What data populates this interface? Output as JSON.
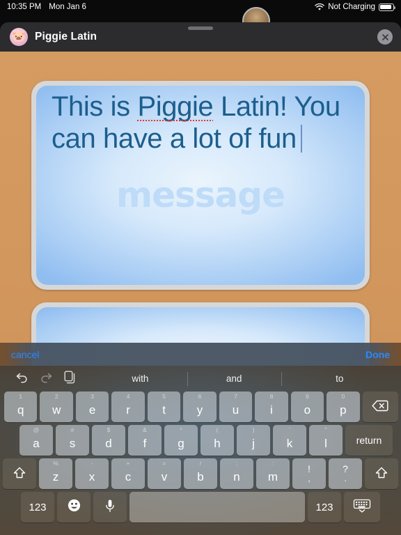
{
  "status_bar": {
    "time": "10:35 PM",
    "date": "Mon Jan 6",
    "wifi_icon": "wifi-icon",
    "charging_text": "Not Charging",
    "battery_icon": "battery-icon"
  },
  "sheet": {
    "app_icon": "🐷",
    "app_title": "Piggie Latin",
    "close_icon": "close-icon",
    "grabber": "drag-handle"
  },
  "message_card": {
    "text_before": "This is ",
    "misspelled_word": "Piggie",
    "text_after": " Latin! You can have a lot of fun",
    "full_text": "This is Piggie Latin! You can have a lot of fun",
    "watermark": "message",
    "text_color": "#1c5e8d",
    "watermark_color": "#bedbf8",
    "spellcheck_color": "#e8342b"
  },
  "accessory_bar": {
    "cancel_label": "cancel",
    "done_label": "Done",
    "accent_color": "#2a8aff"
  },
  "predictive_bar": {
    "undo_icon": "undo-icon",
    "redo_icon": "redo-icon",
    "paste_icon": "paste-icon",
    "suggestions": [
      "with",
      "and",
      "to"
    ]
  },
  "keyboard": {
    "row1": [
      {
        "label": "q",
        "hint": "1"
      },
      {
        "label": "w",
        "hint": "2"
      },
      {
        "label": "e",
        "hint": "3"
      },
      {
        "label": "r",
        "hint": "4"
      },
      {
        "label": "t",
        "hint": "5"
      },
      {
        "label": "y",
        "hint": "6"
      },
      {
        "label": "u",
        "hint": "7"
      },
      {
        "label": "i",
        "hint": "8"
      },
      {
        "label": "o",
        "hint": "9"
      },
      {
        "label": "p",
        "hint": "0"
      }
    ],
    "backspace_icon": "backspace-icon",
    "row2": [
      {
        "label": "a",
        "hint": "@"
      },
      {
        "label": "s",
        "hint": "#"
      },
      {
        "label": "d",
        "hint": "$"
      },
      {
        "label": "f",
        "hint": "&"
      },
      {
        "label": "g",
        "hint": "*"
      },
      {
        "label": "h",
        "hint": "("
      },
      {
        "label": "j",
        "hint": ")"
      },
      {
        "label": "k",
        "hint": "'"
      },
      {
        "label": "l",
        "hint": "\""
      }
    ],
    "return_label": "return",
    "row3": [
      {
        "label": "z",
        "hint": "%"
      },
      {
        "label": "x",
        "hint": "-"
      },
      {
        "label": "c",
        "hint": "+"
      },
      {
        "label": "v",
        "hint": "="
      },
      {
        "label": "b",
        "hint": "/"
      },
      {
        "label": "n",
        "hint": ";"
      },
      {
        "label": "m",
        "hint": ":"
      }
    ],
    "shift_left_icon": "shift-icon",
    "shift_right_icon": "shift-icon",
    "punct_1": {
      "top": "!",
      "bot": ","
    },
    "punct_2": {
      "top": "?",
      "bot": "."
    },
    "row4": {
      "numeric_left": "123",
      "emoji_icon": "emoji-icon",
      "mic_icon": "microphone-icon",
      "space_label": "",
      "numeric_right": "123",
      "dismiss_icon": "keyboard-dismiss-icon"
    }
  }
}
